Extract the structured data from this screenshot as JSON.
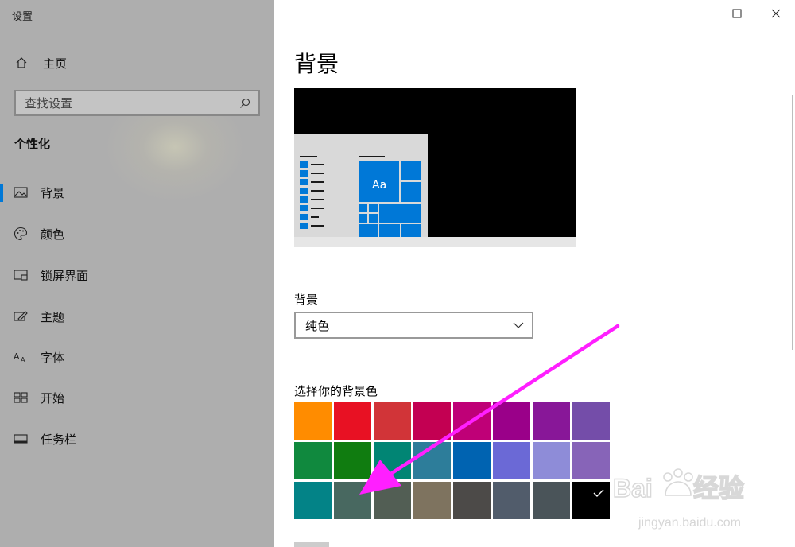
{
  "window": {
    "title": "设置"
  },
  "sidebar": {
    "home_label": "主页",
    "search_placeholder": "查找设置",
    "section_title": "个性化",
    "items": [
      {
        "label": "背景",
        "icon": "picture-icon",
        "active": true
      },
      {
        "label": "颜色",
        "icon": "palette-icon",
        "active": false
      },
      {
        "label": "锁屏界面",
        "icon": "lock-screen-icon",
        "active": false
      },
      {
        "label": "主题",
        "icon": "theme-brush-icon",
        "active": false
      },
      {
        "label": "字体",
        "icon": "font-icon",
        "active": false
      },
      {
        "label": "开始",
        "icon": "start-menu-icon",
        "active": false
      },
      {
        "label": "任务栏",
        "icon": "taskbar-icon",
        "active": false
      }
    ]
  },
  "main": {
    "page_title": "背景",
    "preview_text": "Aa",
    "background_label": "背景",
    "background_value": "纯色",
    "color_label": "选择你的背景色",
    "selected_color_index": 23,
    "swatches": [
      "#ff8c00",
      "#e81123",
      "#d13438",
      "#c30052",
      "#bf0077",
      "#9a0089",
      "#881798",
      "#744da9",
      "#10893e",
      "#107c10",
      "#018574",
      "#2d7d9a",
      "#0063b1",
      "#6b69d6",
      "#8e8cd8",
      "#8764b8",
      "#038387",
      "#486860",
      "#525e54",
      "#7e735f",
      "#4c4a48",
      "#515c6b",
      "#4a5459",
      "#000000"
    ],
    "accent_color": "#0078d7"
  },
  "annotation": {
    "arrow_color": "#ff1fff"
  },
  "watermark": {
    "brand": "Baidu",
    "brand_cn": "经验",
    "url": "jingyan.baidu.com"
  }
}
